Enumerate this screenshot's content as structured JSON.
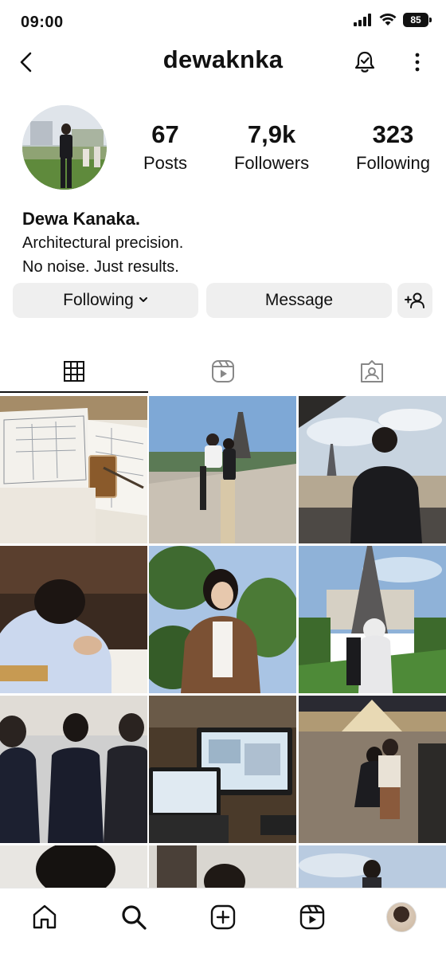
{
  "status_bar": {
    "time": "09:00",
    "battery": "85"
  },
  "header": {
    "username": "dewaknka"
  },
  "profile": {
    "stats": [
      {
        "value": "67",
        "label": "Posts"
      },
      {
        "value": "7,9k",
        "label": "Followers"
      },
      {
        "value": "323",
        "label": "Following"
      }
    ],
    "display_name": "Dewa Kanaka.",
    "bio_lines": [
      "Architectural precision.",
      "No noise. Just results."
    ]
  },
  "actions": {
    "following_label": "Following",
    "message_label": "Message"
  },
  "tabs": [
    {
      "icon": "grid-icon",
      "active": true
    },
    {
      "icon": "reels-icon",
      "active": false
    },
    {
      "icon": "tagged-icon",
      "active": false
    }
  ],
  "grid_posts": [
    {
      "subject": "architectural blueprints with iced coffee"
    },
    {
      "subject": "couple by the Seine with Eiffel Tower"
    },
    {
      "subject": "man looking at Eiffel Tower from balcony"
    },
    {
      "subject": "man in white shirt leaning on desk"
    },
    {
      "subject": "woman in brown leather jacket selfie"
    },
    {
      "subject": "couple in park facing Eiffel Tower"
    },
    {
      "subject": "group of people in black suits"
    },
    {
      "subject": "laptop and monitor with 3D floor plans"
    },
    {
      "subject": "couple sitting near Louvre pyramid at night"
    },
    {
      "subject": "partial post"
    },
    {
      "subject": "partial post"
    },
    {
      "subject": "partial post"
    }
  ],
  "bottom_nav": [
    "home-icon",
    "search-icon",
    "create-icon",
    "reels-icon",
    "profile-avatar"
  ],
  "colors": {
    "button_bg": "#efefef",
    "text": "#111111",
    "divider": "#e6e6e6"
  }
}
